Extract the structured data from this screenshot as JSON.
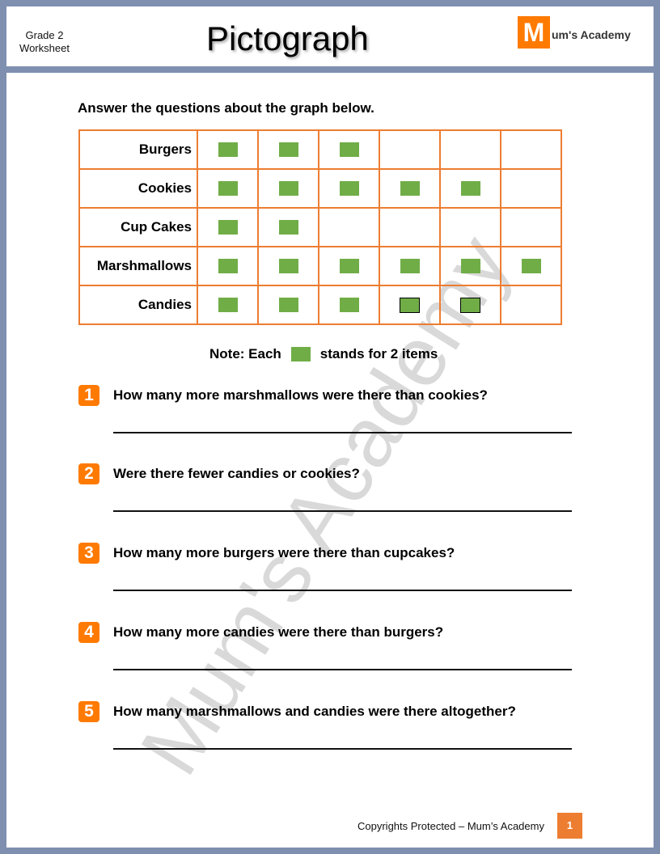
{
  "header": {
    "grade": "Grade 2",
    "worksheet": "Worksheet",
    "title": "Pictograph",
    "logo_letter": "M",
    "logo_text": "um's Academy"
  },
  "instructions": "Answer the questions about the graph below.",
  "chart_data": {
    "type": "table",
    "rows": [
      {
        "label": "Burgers",
        "count": 3,
        "outlined": 0
      },
      {
        "label": "Cookies",
        "count": 5,
        "outlined": 0
      },
      {
        "label": "Cup Cakes",
        "count": 2,
        "outlined": 0
      },
      {
        "label": "Marshmallows",
        "count": 6,
        "outlined": 0
      },
      {
        "label": "Candies",
        "count": 5,
        "outlined": 2
      }
    ],
    "columns": 6,
    "symbol_color": "#70ad47",
    "grid_color": "#ed7d31"
  },
  "note": {
    "prefix": "Note: Each",
    "suffix": "stands for 2 items"
  },
  "questions": [
    {
      "num": "1",
      "text": "How many more marshmallows were there than cookies?"
    },
    {
      "num": "2",
      "text": "Were there fewer candies or cookies?"
    },
    {
      "num": "3",
      "text": "How many more burgers were there than cupcakes?"
    },
    {
      "num": "4",
      "text": "How many more candies were there than burgers?"
    },
    {
      "num": "5",
      "text": "How many marshmallows and candies were there altogether?"
    }
  ],
  "watermark": "Mum's Academy",
  "footer": {
    "text": "Copyrights Protected – Mum’s Academy",
    "page": "1"
  },
  "colors": {
    "accent": "#ff7a00",
    "background": "#7f8fb0"
  }
}
